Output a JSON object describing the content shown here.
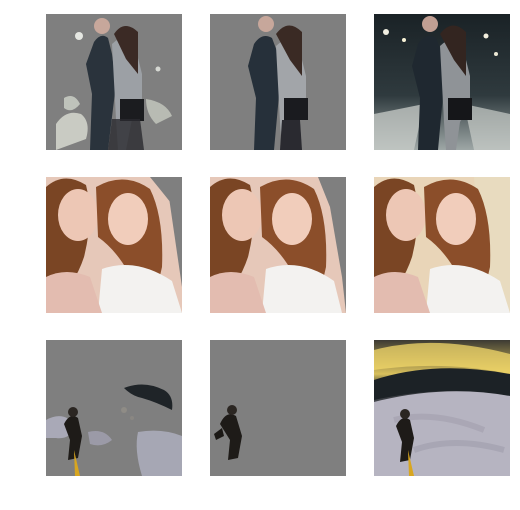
{
  "figure": {
    "rows": [
      {
        "subject": "couple-street-night",
        "panels": [
          "mask-partial",
          "mask-refined",
          "original"
        ]
      },
      {
        "subject": "two-women-portrait",
        "panels": [
          "mask-partial",
          "mask-refined",
          "original"
        ]
      },
      {
        "subject": "hiker-snowy-landscape",
        "panels": [
          "mask-partial",
          "mask-refined",
          "original"
        ]
      }
    ],
    "colors": {
      "background": "#ffffff",
      "masked_gray": "#7f7f7f"
    }
  }
}
